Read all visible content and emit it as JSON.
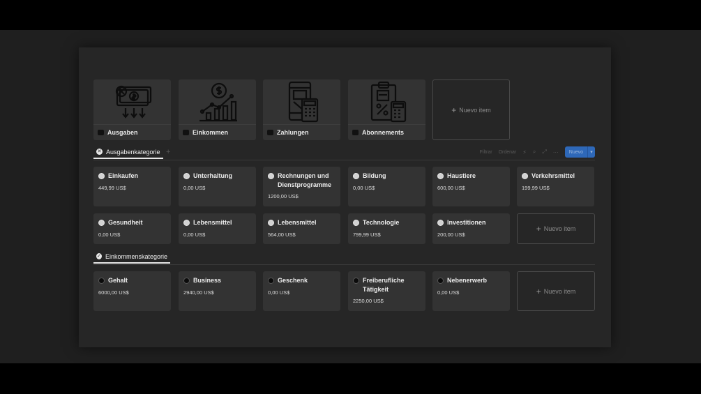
{
  "gallery": [
    {
      "title": "Ausgaben",
      "icon": "money-bills-arrows-down-icon"
    },
    {
      "title": "Einkommen",
      "icon": "dollar-growth-chart-icon"
    },
    {
      "title": "Zahlungen",
      "icon": "phone-calculator-payment-icon"
    },
    {
      "title": "Abonnements",
      "icon": "clipboard-percent-calculator-icon"
    }
  ],
  "new_item": "Nuevo item",
  "expense_tab": {
    "label": "Ausgabenkategorie"
  },
  "income_tab": {
    "label": "Einkommenskategorie"
  },
  "toolbar": {
    "filter": "Filtrar",
    "sort": "Ordenar",
    "new": "Nuevo"
  },
  "expenses": [
    {
      "name": "Einkaufen",
      "value": "449,99 US$"
    },
    {
      "name": "Unterhaltung",
      "value": "0,00 US$"
    },
    {
      "name": "Rechnungen und Dienstprogramme",
      "value": "1200,00 US$"
    },
    {
      "name": "Bildung",
      "value": "0,00 US$"
    },
    {
      "name": "Haustiere",
      "value": "600,00 US$"
    },
    {
      "name": "Verkehrsmittel",
      "value": "199,99 US$"
    },
    {
      "name": "Gesundheit",
      "value": "0,00 US$"
    },
    {
      "name": "Lebensmittel",
      "value": "0,00 US$"
    },
    {
      "name": "Lebensmittel",
      "value": "564,00 US$"
    },
    {
      "name": "Technologie",
      "value": "799,99 US$"
    },
    {
      "name": "Investitionen",
      "value": "200,00 US$"
    }
  ],
  "income": [
    {
      "name": "Gehalt",
      "value": "6000,00 US$"
    },
    {
      "name": "Business",
      "value": "2940,00 US$"
    },
    {
      "name": "Geschenk",
      "value": "0,00 US$"
    },
    {
      "name": "Freiberufliche Tätigkeit",
      "value": "2250,00 US$"
    },
    {
      "name": "Nebenerwerb",
      "value": "0,00 US$"
    }
  ],
  "colors": {
    "accent": "#2e68b8",
    "card": "#333333",
    "panel": "#262626"
  }
}
